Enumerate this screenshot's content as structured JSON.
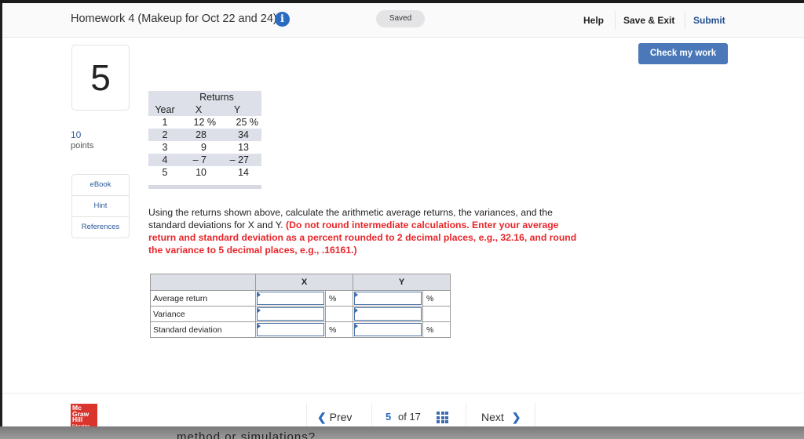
{
  "header": {
    "title": "Homework 4 (Makeup for Oct 22 and 24)",
    "info_icon": "i",
    "status": "Saved",
    "links": {
      "help": "Help",
      "save_exit": "Save & Exit",
      "submit": "Submit"
    }
  },
  "check_button": "Check my work",
  "question": {
    "number": "5",
    "points_value": "10",
    "points_label": "points",
    "resources": [
      "eBook",
      "Hint",
      "References"
    ],
    "returns_table": {
      "group_header": "Returns",
      "columns": [
        "Year",
        "X",
        "Y"
      ],
      "rows": [
        [
          "1",
          "12 %",
          "25 %"
        ],
        [
          "2",
          "28",
          "34"
        ],
        [
          "3",
          "9",
          "13"
        ],
        [
          "4",
          "– 7",
          "– 27"
        ],
        [
          "5",
          "10",
          "14"
        ]
      ]
    },
    "prompt_normal": "Using the returns shown above, calculate the arithmetic average returns, the variances, and the standard deviations for X and Y. ",
    "prompt_emphasis": "(Do not round intermediate calculations. Enter your average return and standard deviation as a percent rounded to 2 decimal places, e.g., 32.16, and round the variance to 5 decimal places, e.g., .16161.)",
    "answer_table": {
      "columns": [
        "",
        "X",
        "Y"
      ],
      "rows": [
        {
          "label": "Average return",
          "x_value": "",
          "x_unit": "%",
          "y_value": "",
          "y_unit": "%"
        },
        {
          "label": "Variance",
          "x_value": "",
          "x_unit": "",
          "y_value": "",
          "y_unit": ""
        },
        {
          "label": "Standard deviation",
          "x_value": "",
          "x_unit": "%",
          "y_value": "",
          "y_unit": "%"
        }
      ]
    }
  },
  "footer": {
    "logo_lines": [
      "Mc",
      "Graw",
      "Hill",
      "Education"
    ],
    "prev": "Prev",
    "next": "Next",
    "current_page": "5",
    "of_label": "of 17"
  },
  "background_text": "method or simulations?",
  "colors": {
    "accent": "#2a6bbf",
    "button": "#4a78b8",
    "emphasis": "#e8262b",
    "logo": "#d9352c"
  }
}
